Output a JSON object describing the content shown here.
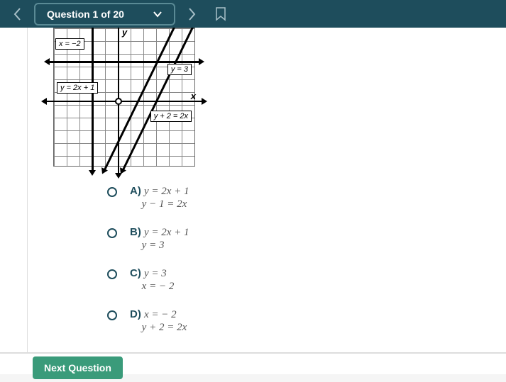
{
  "header": {
    "question_label": "Question 1 of 20"
  },
  "graph": {
    "axis_x": "x",
    "axis_y": "y",
    "labels": {
      "l1": "x = −2",
      "l2": "y = 3",
      "l3": "y = 2x + 1",
      "l4": "y + 2 = 2x"
    }
  },
  "answers": {
    "a": {
      "label": "A)",
      "line1": "y = 2x + 1",
      "line2": "y − 1 = 2x"
    },
    "b": {
      "label": "B)",
      "line1": "y = 2x + 1",
      "line2": "y = 3"
    },
    "c": {
      "label": "C)",
      "line1": "y = 3",
      "line2": "x = − 2"
    },
    "d": {
      "label": "D)",
      "line1": "x = − 2",
      "line2": "y + 2 = 2x"
    }
  },
  "footer": {
    "next": "Next Question"
  }
}
